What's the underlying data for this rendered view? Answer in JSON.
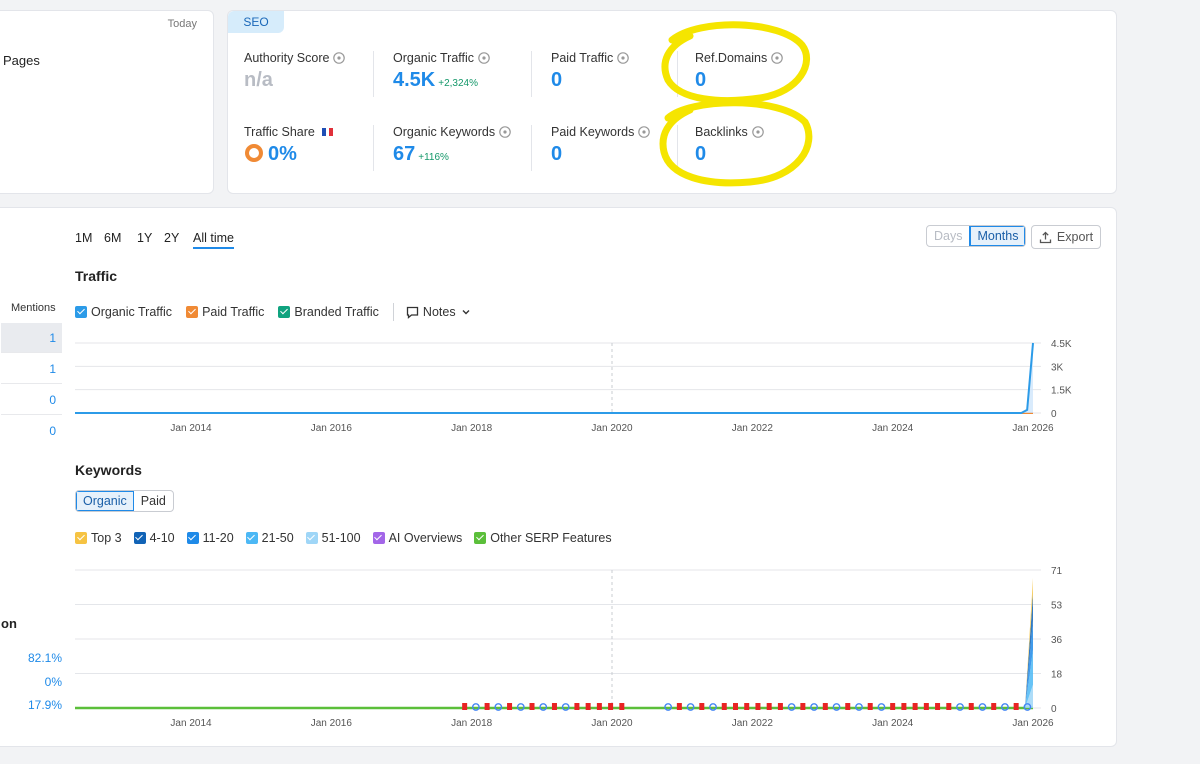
{
  "left_panel": {
    "today": "Today",
    "pages_label": "Pages"
  },
  "seo": {
    "tab": "SEO",
    "authority_score": {
      "label": "Authority Score",
      "value": "n/a"
    },
    "organic_traffic": {
      "label": "Organic Traffic",
      "value": "4.5K",
      "delta": "+2,324%"
    },
    "paid_traffic": {
      "label": "Paid Traffic",
      "value": "0"
    },
    "ref_domains": {
      "label": "Ref.Domains",
      "value": "0"
    },
    "traffic_share": {
      "label": "Traffic Share",
      "value": "0%"
    },
    "organic_keywords": {
      "label": "Organic Keywords",
      "value": "67",
      "delta": "+116%"
    },
    "paid_keywords": {
      "label": "Paid Keywords",
      "value": "0"
    },
    "backlinks": {
      "label": "Backlinks",
      "value": "0"
    }
  },
  "periods": [
    "1M",
    "6M",
    "1Y",
    "2Y",
    "All time"
  ],
  "active_period": "All time",
  "granularity": {
    "days": "Days",
    "months": "Months",
    "active": "Months"
  },
  "export_label": "Export",
  "traffic": {
    "title": "Traffic",
    "legend": [
      {
        "label": "Organic Traffic",
        "color": "#2c9be8"
      },
      {
        "label": "Paid Traffic",
        "color": "#f08a35"
      },
      {
        "label": "Branded Traffic",
        "color": "#10a37f"
      }
    ],
    "notes_label": "Notes"
  },
  "keywords": {
    "title": "Keywords",
    "toggle": [
      "Organic",
      "Paid"
    ],
    "active_toggle": "Organic",
    "legend": [
      {
        "label": "Top 3",
        "color": "#f6c342"
      },
      {
        "label": "4-10",
        "color": "#1163b6"
      },
      {
        "label": "11-20",
        "color": "#1f8ae8"
      },
      {
        "label": "21-50",
        "color": "#4cb8f5"
      },
      {
        "label": "51-100",
        "color": "#9fd6f7"
      },
      {
        "label": "AI Overviews",
        "color": "#a366e8"
      },
      {
        "label": "Other SERP Features",
        "color": "#5bbf3a"
      }
    ]
  },
  "mentions": {
    "header": "Mentions",
    "values": [
      "1",
      "1",
      "0",
      "0"
    ]
  },
  "left_section": {
    "label": "on",
    "percents": [
      "82.1%",
      "0%",
      "17.9%"
    ]
  },
  "chart_data": [
    {
      "type": "line",
      "title": "Traffic",
      "x_ticks": [
        "Jan 2014",
        "Jan 2016",
        "Jan 2018",
        "Jan 2020",
        "Jan 2022",
        "Jan 2024",
        "Jan 2026"
      ],
      "y_ticks": [
        "0",
        "1.5K",
        "3K",
        "4.5K"
      ],
      "ylim": [
        0,
        4500
      ],
      "series": [
        {
          "name": "Organic Traffic",
          "x": [
            "2012-01",
            "2025-11",
            "2025-12",
            "2026-01"
          ],
          "values": [
            0,
            0,
            200,
            4500
          ]
        },
        {
          "name": "Paid Traffic",
          "x": [
            "2012-01",
            "2026-01"
          ],
          "values": [
            0,
            0
          ]
        },
        {
          "name": "Branded Traffic",
          "x": [
            "2012-01",
            "2026-01"
          ],
          "values": [
            0,
            0
          ]
        }
      ]
    },
    {
      "type": "area",
      "title": "Keywords",
      "x_ticks": [
        "Jan 2014",
        "Jan 2016",
        "Jan 2018",
        "Jan 2020",
        "Jan 2022",
        "Jan 2024",
        "Jan 2026"
      ],
      "y_ticks": [
        "0",
        "18",
        "36",
        "53",
        "71"
      ],
      "ylim": [
        0,
        71
      ],
      "series": [
        {
          "name": "Top 3",
          "x": [
            "2025-12",
            "2026-01"
          ],
          "values": [
            0,
            8
          ]
        },
        {
          "name": "4-10",
          "x": [
            "2025-12",
            "2026-01"
          ],
          "values": [
            0,
            14
          ]
        },
        {
          "name": "11-20",
          "x": [
            "2025-12",
            "2026-01"
          ],
          "values": [
            0,
            15
          ]
        },
        {
          "name": "21-50",
          "x": [
            "2025-12",
            "2026-01"
          ],
          "values": [
            0,
            18
          ]
        },
        {
          "name": "51-100",
          "x": [
            "2025-12",
            "2026-01"
          ],
          "values": [
            0,
            12
          ]
        },
        {
          "name": "AI Overviews",
          "x": [
            "2012-01",
            "2026-01"
          ],
          "values": [
            0,
            0
          ]
        },
        {
          "name": "Other SERP Features",
          "x": [
            "2012-01",
            "2026-01"
          ],
          "values": [
            0,
            0
          ]
        }
      ]
    }
  ]
}
